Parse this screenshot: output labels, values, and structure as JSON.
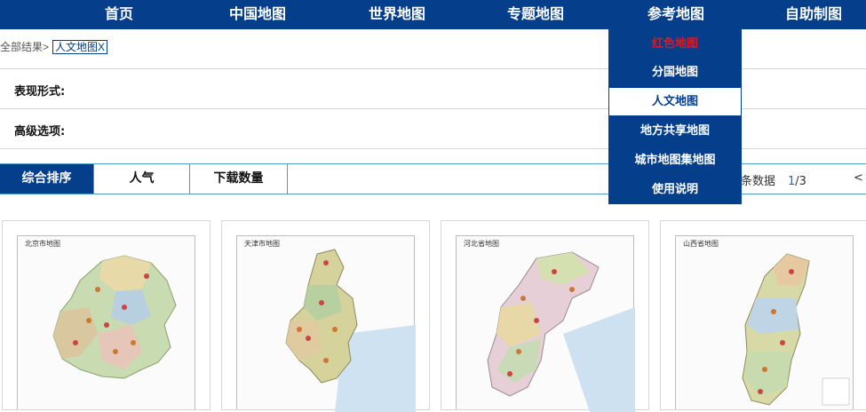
{
  "nav": {
    "items": [
      "首页",
      "中国地图",
      "世界地图",
      "专题地图",
      "参考地图",
      "自助制图"
    ],
    "bg_color": "#053f8b"
  },
  "dropdown": {
    "items": [
      "红色地图",
      "分国地图",
      "人文地图",
      "地方共享地图",
      "城市地图集地图",
      "使用说明"
    ],
    "selected": "人文地图",
    "highlight_color": "#e8141c"
  },
  "breadcrumb": {
    "prefix": "全部结果>",
    "tag": "人文地图X"
  },
  "filters": {
    "form_label": "表现形式:",
    "advanced_label": "高级选项:"
  },
  "sort": {
    "tabs": [
      "综合排序",
      "人气",
      "下载数量"
    ],
    "active": "综合排序"
  },
  "pager": {
    "records_text": "条数据",
    "current": "1",
    "total": "/3",
    "prev": "<"
  },
  "cards": [
    {
      "title": "北京市地图"
    },
    {
      "title": "天津市地图"
    },
    {
      "title": "河北省地图"
    },
    {
      "title": "山西省地图"
    }
  ]
}
